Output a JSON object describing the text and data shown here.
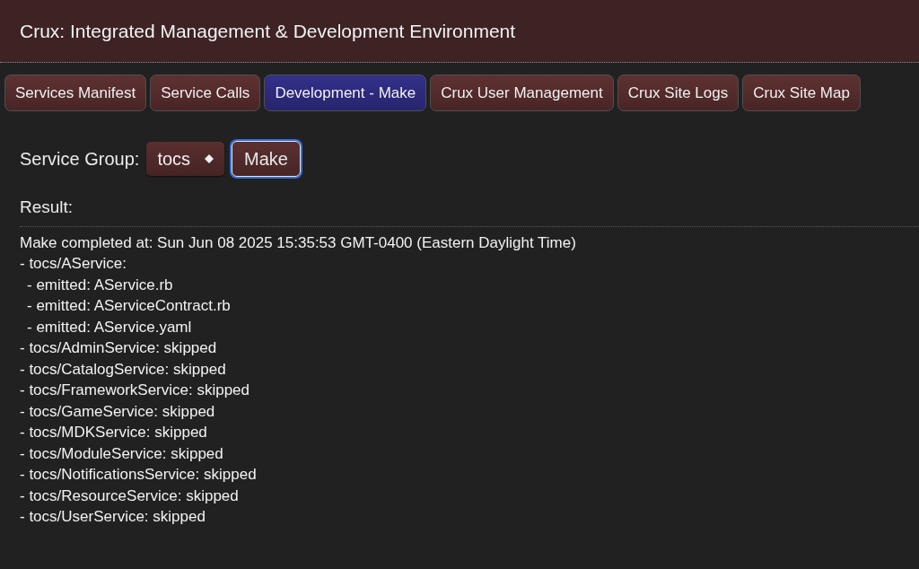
{
  "header": {
    "title": "Crux: Integrated Management & Development Environment"
  },
  "tabs": [
    {
      "label": "Services Manifest",
      "selected": false
    },
    {
      "label": "Service Calls",
      "selected": false
    },
    {
      "label": "Development - Make",
      "selected": true
    },
    {
      "label": "Crux User Management",
      "selected": false
    },
    {
      "label": "Crux Site Logs",
      "selected": false
    },
    {
      "label": "Crux Site Map",
      "selected": false
    }
  ],
  "controls": {
    "label": "Service Group:",
    "select": {
      "value": "tocs"
    },
    "make_button": {
      "label": "Make",
      "focused": true
    }
  },
  "result": {
    "heading": "Result:",
    "lines": [
      {
        "text": "Make completed at: Sun Jun 08 2025 15:35:53 GMT-0400 (Eastern Daylight Time)"
      },
      {
        "text": "- tocs/AService:",
        "children": [
          {
            "text": "- emitted: AService.rb"
          },
          {
            "text": "- emitted: AServiceContract.rb"
          },
          {
            "text": "- emitted: AService.yaml"
          }
        ]
      },
      {
        "text": "- tocs/AdminService: skipped"
      },
      {
        "text": "- tocs/CatalogService: skipped"
      },
      {
        "text": "- tocs/FrameworkService: skipped"
      },
      {
        "text": "- tocs/GameService: skipped"
      },
      {
        "text": "- tocs/MDKService: skipped"
      },
      {
        "text": "- tocs/ModuleService: skipped"
      },
      {
        "text": "- tocs/NotificationsService: skipped"
      },
      {
        "text": "- tocs/ResourceService: skipped"
      },
      {
        "text": "- tocs/UserService: skipped"
      }
    ]
  }
}
